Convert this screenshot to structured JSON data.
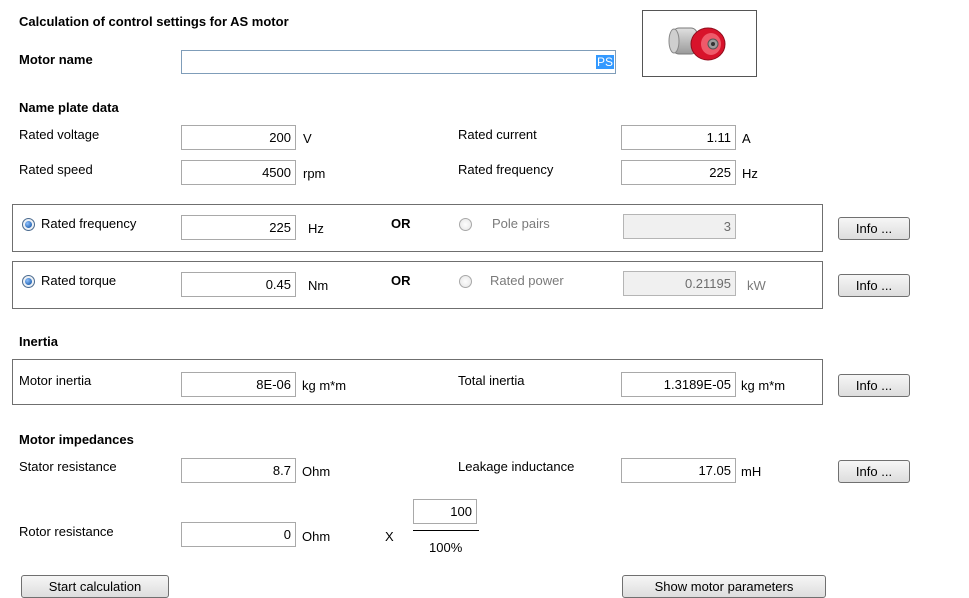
{
  "title": "Calculation of control settings for AS motor",
  "motor_name": {
    "label": "Motor name",
    "value": "",
    "ime_badge": "PS"
  },
  "nameplate": {
    "heading": "Name plate data",
    "rated_voltage": {
      "label": "Rated voltage",
      "value": "200",
      "unit": "V"
    },
    "rated_speed": {
      "label": "Rated speed",
      "value": "4500",
      "unit": "rpm"
    },
    "rated_current": {
      "label": "Rated current",
      "value": "1.11",
      "unit": "A"
    },
    "rated_frequency": {
      "label": "Rated frequency",
      "value": "225",
      "unit": "Hz"
    }
  },
  "freq_group": {
    "option_a": {
      "label": "Rated frequency",
      "value": "225",
      "unit": "Hz",
      "selected": true
    },
    "or": "OR",
    "option_b": {
      "label": "Pole pairs",
      "value": "3",
      "unit": "",
      "selected": false
    },
    "info": "Info ..."
  },
  "torque_group": {
    "option_a": {
      "label": "Rated torque",
      "value": "0.45",
      "unit": "Nm",
      "selected": true
    },
    "or": "OR",
    "option_b": {
      "label": "Rated power",
      "value": "0.21195",
      "unit": "kW",
      "selected": false
    },
    "info": "Info ..."
  },
  "inertia": {
    "heading": "Inertia",
    "motor_inertia": {
      "label": "Motor inertia",
      "value": "8E-06",
      "unit": "kg m*m"
    },
    "total_inertia": {
      "label": "Total inertia",
      "value": "1.3189E-05",
      "unit": "kg m*m"
    },
    "info": "Info ..."
  },
  "impedances": {
    "heading": "Motor impedances",
    "stator_resistance": {
      "label": "Stator resistance",
      "value": "8.7",
      "unit": "Ohm"
    },
    "leakage_inductance": {
      "label": "Leakage inductance",
      "value": "17.05",
      "unit": "mH"
    },
    "rotor_resistance": {
      "label": "Rotor resistance",
      "value": "0",
      "unit": "Ohm"
    },
    "multiply": "X",
    "factor_value": "100",
    "factor_denominator": "100%",
    "info": "Info ..."
  },
  "buttons": {
    "start": "Start calculation",
    "show": "Show motor parameters"
  },
  "colors": {
    "selection": "#3399ff",
    "motor_red": "#d8132b",
    "motor_gray": "#b8b8b8"
  }
}
